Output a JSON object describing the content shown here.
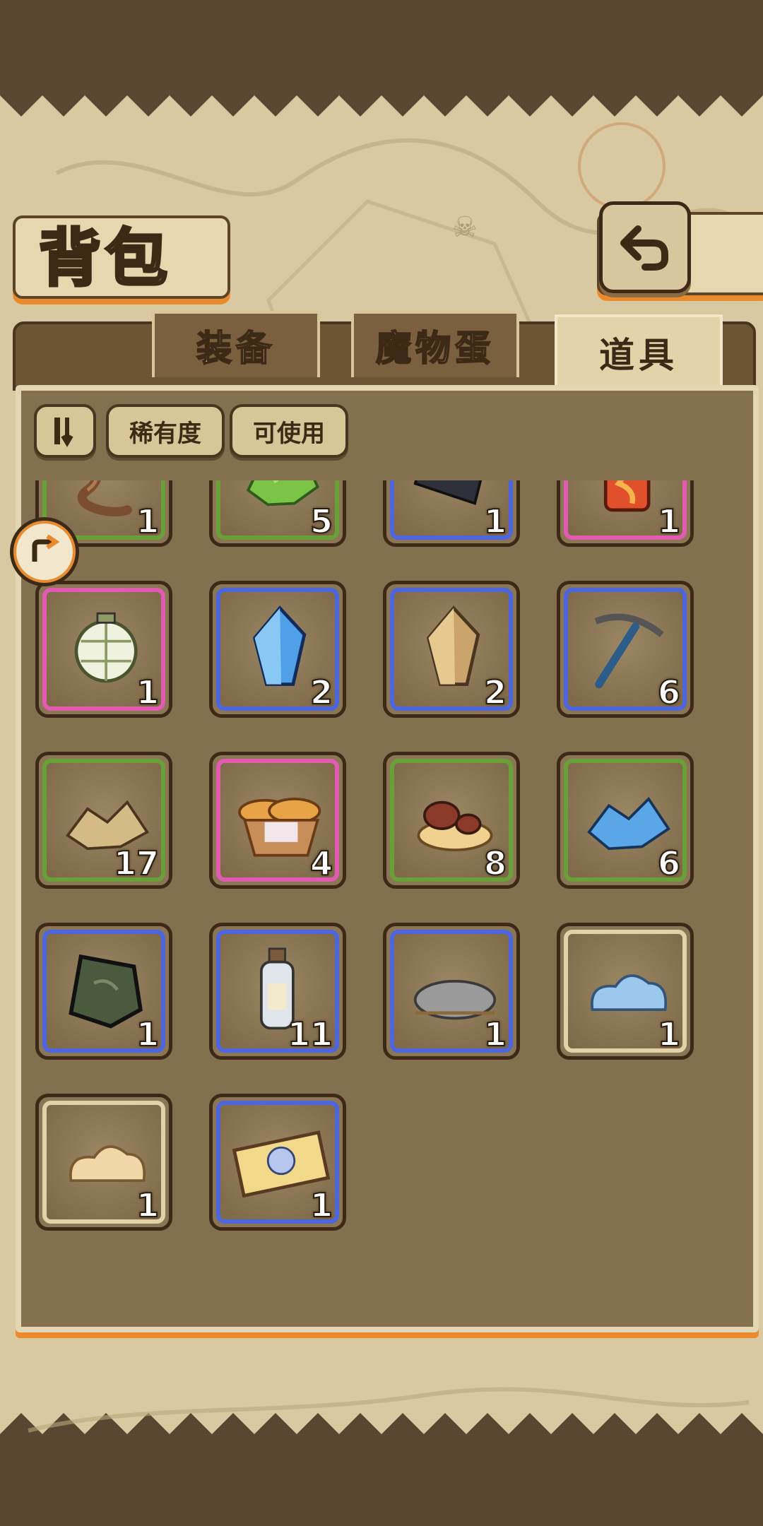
{
  "header": {
    "title": "背包"
  },
  "tabs": [
    {
      "label": "装备",
      "active": false
    },
    {
      "label": "魔物蛋",
      "active": false
    },
    {
      "label": "道具",
      "active": true
    }
  ],
  "filters": {
    "sort_icon": "sort-order-icon",
    "rarity": "稀有度",
    "usable": "可使用"
  },
  "items": [
    {
      "icon": "rope-icon",
      "rarity": "green",
      "count": "1"
    },
    {
      "icon": "green-crystals-icon",
      "rarity": "green",
      "count": "5"
    },
    {
      "icon": "dark-bar-icon",
      "rarity": "blue",
      "count": "1"
    },
    {
      "icon": "fire-gem-icon",
      "rarity": "pink",
      "count": "1"
    },
    {
      "icon": "lantern-icon",
      "rarity": "pink",
      "count": "1"
    },
    {
      "icon": "blue-crystal-icon",
      "rarity": "blue",
      "count": "2"
    },
    {
      "icon": "amber-crystal-icon",
      "rarity": "blue",
      "count": "2"
    },
    {
      "icon": "pickaxe-icon",
      "rarity": "blue",
      "count": "6"
    },
    {
      "icon": "gold-ore-icon",
      "rarity": "green",
      "count": "17"
    },
    {
      "icon": "bread-basket-icon",
      "rarity": "pink",
      "count": "4"
    },
    {
      "icon": "mushroom-icon",
      "rarity": "green",
      "count": "8"
    },
    {
      "icon": "blue-ore-icon",
      "rarity": "green",
      "count": "6"
    },
    {
      "icon": "stone-tablet-icon",
      "rarity": "blue",
      "count": "1"
    },
    {
      "icon": "message-bottle-icon",
      "rarity": "blue",
      "count": "11"
    },
    {
      "icon": "gray-nest-icon",
      "rarity": "blue",
      "count": "1"
    },
    {
      "icon": "blue-slime-icon",
      "rarity": "beige",
      "count": "1"
    },
    {
      "icon": "sand-pile-icon",
      "rarity": "beige",
      "count": "1"
    },
    {
      "icon": "ticket-icon",
      "rarity": "blue",
      "count": "1"
    }
  ],
  "colors": {
    "accent": "#e98a2d",
    "rarity_green": "#6aa038",
    "rarity_blue": "#4d66de",
    "rarity_pink": "#e25bb0",
    "rarity_beige": "#e3d2a8"
  }
}
